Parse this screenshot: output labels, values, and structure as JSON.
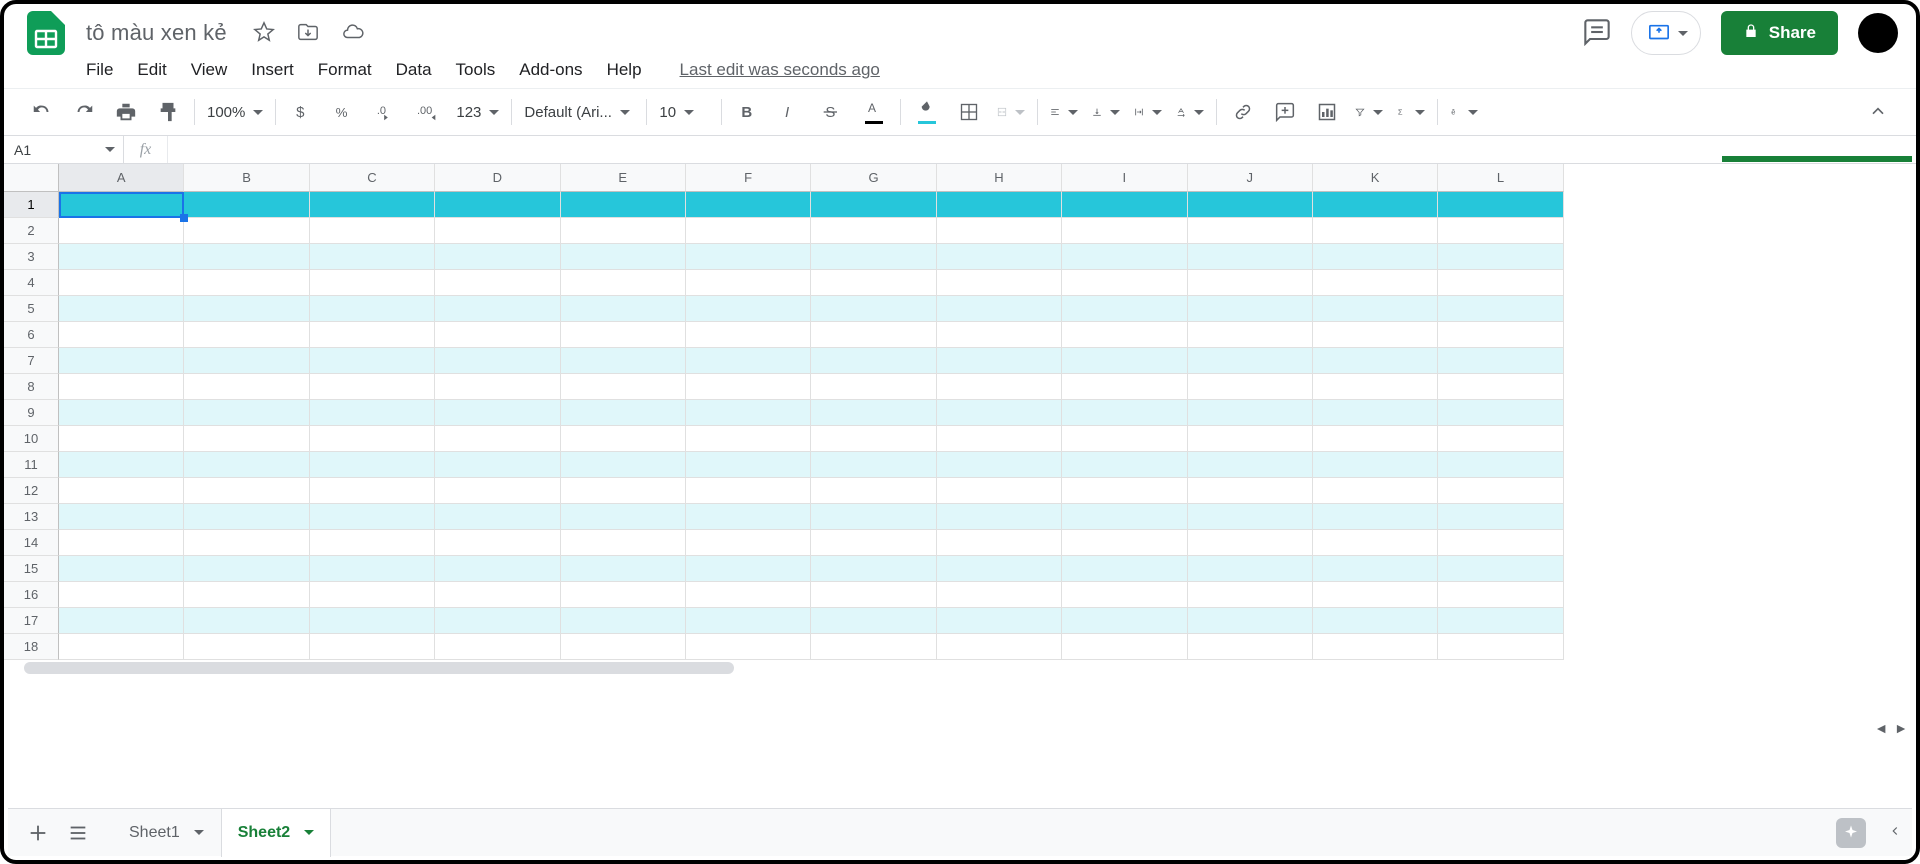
{
  "doc": {
    "title": "tô màu xen kẻ"
  },
  "menubar": {
    "file": "File",
    "edit": "Edit",
    "view": "View",
    "insert": "Insert",
    "format": "Format",
    "data": "Data",
    "tools": "Tools",
    "addons": "Add-ons",
    "help": "Help",
    "last_edit": "Last edit was seconds ago"
  },
  "toolbar": {
    "zoom": "100%",
    "format_123": "123",
    "font": "Default (Ari...",
    "fontsize": "10"
  },
  "share": {
    "label": "Share"
  },
  "namebox": {
    "value": "A1"
  },
  "fx": {
    "label": "fx"
  },
  "columns": [
    "A",
    "B",
    "C",
    "D",
    "E",
    "F",
    "G",
    "H",
    "I",
    "J",
    "K",
    "L"
  ],
  "rows": [
    "1",
    "2",
    "3",
    "4",
    "5",
    "6",
    "7",
    "8",
    "9",
    "10",
    "11",
    "12",
    "13",
    "14",
    "15",
    "16",
    "17",
    "18"
  ],
  "sheets": {
    "tabs": [
      {
        "name": "Sheet1",
        "active": false
      },
      {
        "name": "Sheet2",
        "active": true
      }
    ]
  },
  "selected": {
    "cell_ref": "A1",
    "col": "A",
    "row": "1"
  }
}
